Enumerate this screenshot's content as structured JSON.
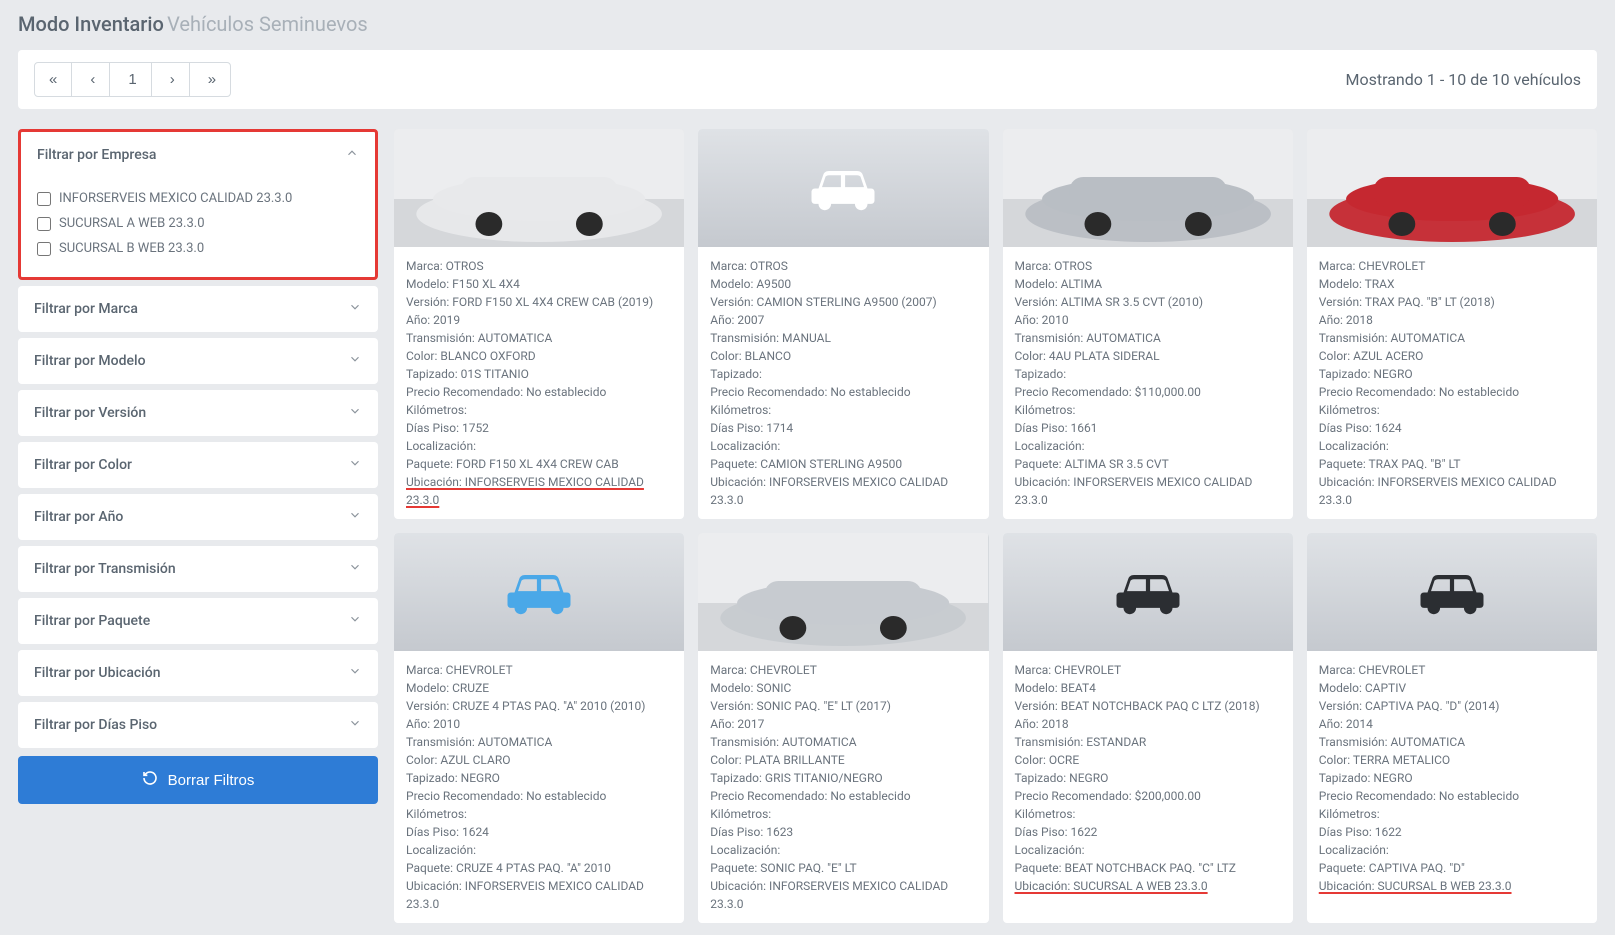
{
  "header": {
    "title": "Modo Inventario",
    "subtitle": "Vehículos Seminuevos"
  },
  "pager": {
    "current": "1",
    "summary": "Mostrando 1 - 10 de 10 vehículos"
  },
  "labels": {
    "marca": "Marca:",
    "modelo": "Modelo:",
    "version": "Versión:",
    "ano": "Año:",
    "transmision": "Transmisión:",
    "color": "Color:",
    "tapizado": "Tapizado:",
    "precio": "Precio Recomendado:",
    "km": "Kilómetros:",
    "dias": "Días Piso:",
    "loc": "Localización:",
    "paquete": "Paquete:",
    "ubic": "Ubicación:"
  },
  "filters": {
    "empresa": {
      "title": "Filtrar por Empresa",
      "expanded": true,
      "options": [
        "INFORSERVEIS MEXICO CALIDAD 23.3.0",
        "SUCURSAL A WEB 23.3.0",
        "SUCURSAL B WEB 23.3.0"
      ]
    },
    "collapsed": [
      "Filtrar por Marca",
      "Filtrar por Modelo",
      "Filtrar por Versión",
      "Filtrar por Color",
      "Filtrar por Año",
      "Filtrar por Transmisión",
      "Filtrar por Paquete",
      "Filtrar por Ubicación",
      "Filtrar por Días Piso"
    ],
    "clear": "Borrar Filtros"
  },
  "cards": [
    {
      "img": "photo-white",
      "marca": "OTROS",
      "modelo": "F150 XL 4X4",
      "version": "FORD F150 XL 4X4 CREW CAB (2019)",
      "ano": "2019",
      "trans": "AUTOMATICA",
      "color": "BLANCO OXFORD",
      "tapizado": "01S TITANIO",
      "precio": "No establecido",
      "km": "",
      "dias": "1752",
      "loc": "",
      "paquete": "FORD F150 XL 4X4 CREW CAB",
      "ubic": "INFORSERVEIS MEXICO CALIDAD 23.3.0",
      "ul": true
    },
    {
      "img": "ph-white",
      "marca": "OTROS",
      "modelo": "A9500",
      "version": "CAMION STERLING A9500 (2007)",
      "ano": "2007",
      "trans": "MANUAL",
      "color": "BLANCO",
      "tapizado": "",
      "precio": "No establecido",
      "km": "",
      "dias": "1714",
      "loc": "",
      "paquete": "CAMION STERLING A9500",
      "ubic": "INFORSERVEIS MEXICO CALIDAD 23.3.0",
      "ul": false
    },
    {
      "img": "photo-silver",
      "marca": "OTROS",
      "modelo": "ALTIMA",
      "version": "ALTIMA SR 3.5 CVT (2010)",
      "ano": "2010",
      "trans": "AUTOMATICA",
      "color": "4AU PLATA SIDERAL",
      "tapizado": "",
      "precio": "$110,000.00",
      "km": "",
      "dias": "1661",
      "loc": "",
      "paquete": "ALTIMA SR 3.5 CVT",
      "ubic": "INFORSERVEIS MEXICO CALIDAD 23.3.0",
      "ul": false
    },
    {
      "img": "photo-red",
      "marca": "CHEVROLET",
      "modelo": "TRAX",
      "version": "TRAX PAQ. \"B\" LT (2018)",
      "ano": "2018",
      "trans": "AUTOMATICA",
      "color": "AZUL ACERO",
      "tapizado": "NEGRO",
      "precio": "No establecido",
      "km": "",
      "dias": "1624",
      "loc": "",
      "paquete": "TRAX PAQ. \"B\" LT",
      "ubic": "INFORSERVEIS MEXICO CALIDAD 23.3.0",
      "ul": false
    },
    {
      "img": "ph-blue",
      "marca": "CHEVROLET",
      "modelo": "CRUZE",
      "version": "CRUZE 4 PTAS PAQ. \"A\" 2010 (2010)",
      "ano": "2010",
      "trans": "AUTOMATICA",
      "color": "AZUL CLARO",
      "tapizado": "NEGRO",
      "precio": "No establecido",
      "km": "",
      "dias": "1624",
      "loc": "",
      "paquete": "CRUZE 4 PTAS PAQ. \"A\" 2010",
      "ubic": "INFORSERVEIS MEXICO CALIDAD 23.3.0",
      "ul": false
    },
    {
      "img": "photo-silver2",
      "marca": "CHEVROLET",
      "modelo": "SONIC",
      "version": "SONIC PAQ. \"E\" LT (2017)",
      "ano": "2017",
      "trans": "AUTOMATICA",
      "color": "PLATA BRILLANTE",
      "tapizado": "GRIS TITANIO/NEGRO",
      "precio": "No establecido",
      "km": "",
      "dias": "1623",
      "loc": "",
      "paquete": "SONIC PAQ. \"E\" LT",
      "ubic": "INFORSERVEIS MEXICO CALIDAD 23.3.0",
      "ul": false
    },
    {
      "img": "ph-dark",
      "marca": "CHEVROLET",
      "modelo": "BEAT4",
      "version": "BEAT NOTCHBACK PAQ C LTZ (2018)",
      "ano": "2018",
      "trans": "ESTANDAR",
      "color": "OCRE",
      "tapizado": "NEGRO",
      "precio": "$200,000.00",
      "km": "",
      "dias": "1622",
      "loc": "",
      "paquete": "BEAT NOTCHBACK PAQ. \"C\" LTZ",
      "ubic": "SUCURSAL A WEB 23.3.0",
      "ul": true
    },
    {
      "img": "ph-dark",
      "marca": "CHEVROLET",
      "modelo": "CAPTIV",
      "version": "CAPTIVA PAQ. \"D\" (2014)",
      "ano": "2014",
      "trans": "AUTOMATICA",
      "color": "TERRA METALICO",
      "tapizado": "NEGRO",
      "precio": "No establecido",
      "km": "",
      "dias": "1622",
      "loc": "",
      "paquete": "CAPTIVA PAQ. \"D\"",
      "ubic": "SUCURSAL B WEB 23.3.0",
      "ul": true
    }
  ]
}
